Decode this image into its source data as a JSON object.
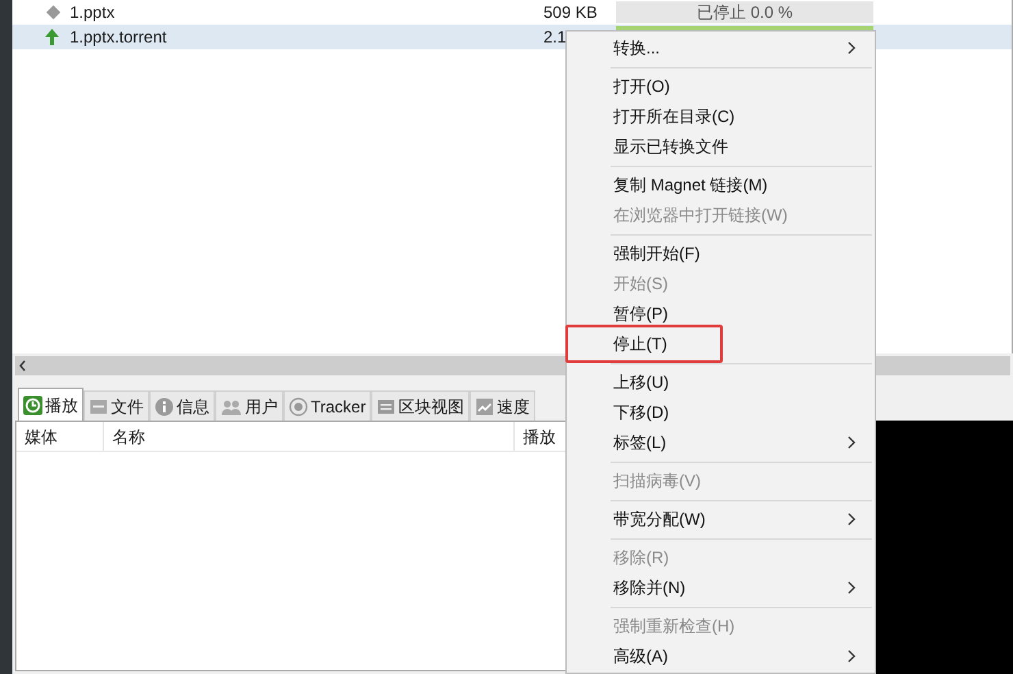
{
  "files": [
    {
      "name": "1.pptx",
      "size": "509 KB",
      "status": "已停止 0.0 %",
      "color": "#e6e6e6",
      "selected": false
    },
    {
      "name": "1.pptx.torrent",
      "size": "2.1",
      "color": "#a6d372",
      "selected": true
    }
  ],
  "tabs": [
    {
      "label": "播放",
      "selected": true
    },
    {
      "label": "文件",
      "selected": false
    },
    {
      "label": "信息",
      "selected": false
    },
    {
      "label": "用户",
      "selected": false
    },
    {
      "label": "Tracker",
      "selected": false
    },
    {
      "label": "区块视图",
      "selected": false
    },
    {
      "label": "速度",
      "selected": false
    }
  ],
  "table": {
    "columns": [
      "媒体",
      "名称",
      "播放"
    ]
  },
  "context_menu": [
    {
      "kind": "item",
      "label": "转换...",
      "disabled": false,
      "submenu": true,
      "highlighted": false
    },
    {
      "kind": "separator"
    },
    {
      "kind": "item",
      "label": "打开(O)",
      "disabled": false,
      "submenu": false,
      "highlighted": false
    },
    {
      "kind": "item",
      "label": "打开所在目录(C)",
      "disabled": false,
      "submenu": false,
      "highlighted": false
    },
    {
      "kind": "item",
      "label": "显示已转换文件",
      "disabled": false,
      "submenu": false,
      "highlighted": false
    },
    {
      "kind": "separator"
    },
    {
      "kind": "item",
      "label": "复制 Magnet 链接(M)",
      "disabled": false,
      "submenu": false,
      "highlighted": false
    },
    {
      "kind": "item",
      "label": "在浏览器中打开链接(W)",
      "disabled": true,
      "submenu": false,
      "highlighted": false
    },
    {
      "kind": "separator"
    },
    {
      "kind": "item",
      "label": "强制开始(F)",
      "disabled": false,
      "submenu": false,
      "highlighted": false
    },
    {
      "kind": "item",
      "label": "开始(S)",
      "disabled": true,
      "submenu": false,
      "highlighted": false
    },
    {
      "kind": "item",
      "label": "暂停(P)",
      "disabled": false,
      "submenu": false,
      "highlighted": false
    },
    {
      "kind": "item",
      "label": "停止(T)",
      "disabled": false,
      "submenu": false,
      "highlighted": true
    },
    {
      "kind": "separator"
    },
    {
      "kind": "item",
      "label": "上移(U)",
      "disabled": false,
      "submenu": false,
      "highlighted": false
    },
    {
      "kind": "item",
      "label": "下移(D)",
      "disabled": false,
      "submenu": false,
      "highlighted": false
    },
    {
      "kind": "item",
      "label": "标签(L)",
      "disabled": false,
      "submenu": true,
      "highlighted": false
    },
    {
      "kind": "separator"
    },
    {
      "kind": "item",
      "label": "扫描病毒(V)",
      "disabled": true,
      "submenu": false,
      "highlighted": false
    },
    {
      "kind": "separator"
    },
    {
      "kind": "item",
      "label": "带宽分配(W)",
      "disabled": false,
      "submenu": true,
      "highlighted": false
    },
    {
      "kind": "separator"
    },
    {
      "kind": "item",
      "label": "移除(R)",
      "disabled": true,
      "submenu": false,
      "highlighted": false
    },
    {
      "kind": "item",
      "label": "移除并(N)",
      "disabled": false,
      "submenu": true,
      "highlighted": false
    },
    {
      "kind": "separator"
    },
    {
      "kind": "item",
      "label": "强制重新检查(H)",
      "disabled": true,
      "submenu": false,
      "highlighted": false
    },
    {
      "kind": "item",
      "label": "高级(A)",
      "disabled": false,
      "submenu": true,
      "highlighted": false
    }
  ]
}
